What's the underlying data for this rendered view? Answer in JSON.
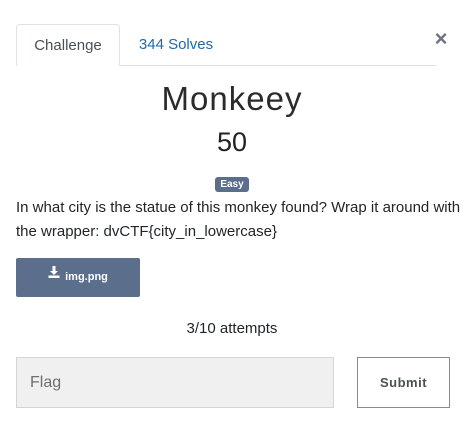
{
  "tabs": {
    "challenge": "Challenge",
    "solves": "344 Solves"
  },
  "close_label": "×",
  "challenge": {
    "name": "Monkeey",
    "points": "50",
    "difficulty": "Easy",
    "description": "In what city is the statue of this monkey found? Wrap it around with the wrapper: dvCTF{city_in_lowercase}"
  },
  "file": {
    "name": "img.png",
    "icon": "download-icon"
  },
  "attempts": "3/10 attempts",
  "flag_form": {
    "placeholder": "Flag",
    "value": "",
    "submit_label": "Submit"
  },
  "colors": {
    "accent": "#5b6f8c",
    "link": "#1e6aa8"
  }
}
